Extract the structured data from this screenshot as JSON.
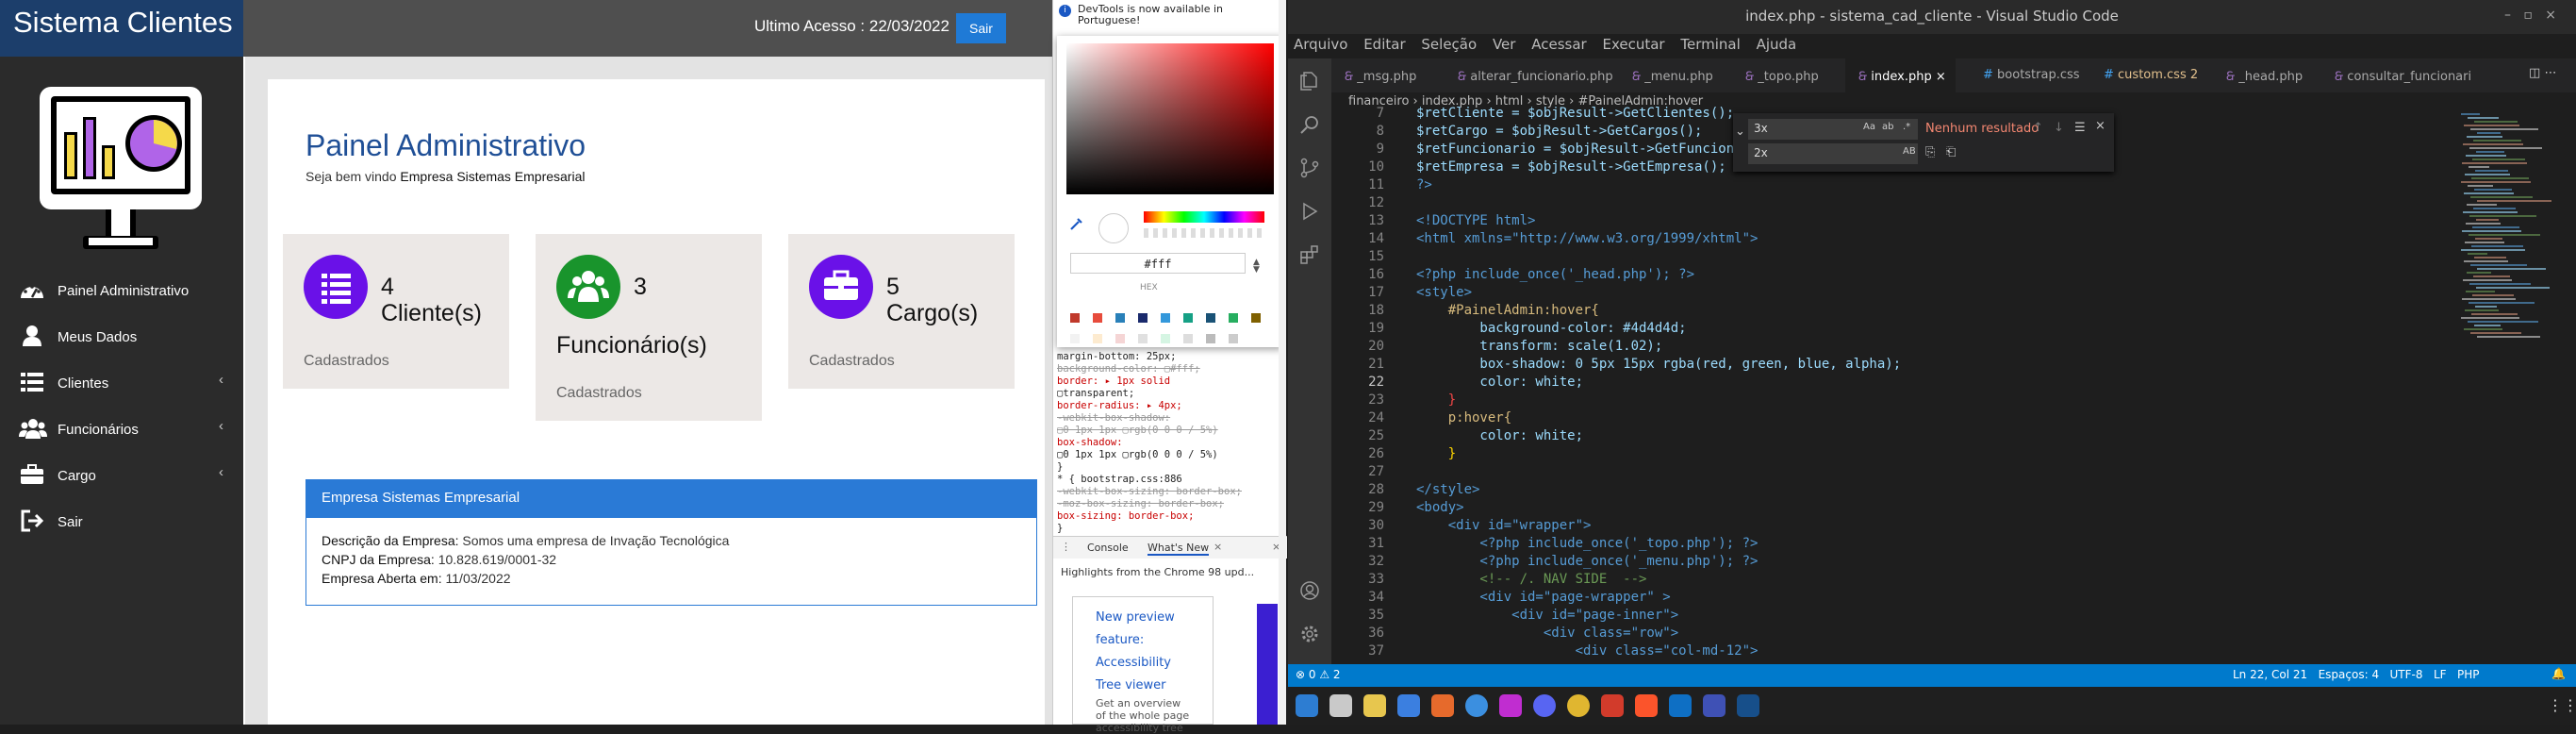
{
  "sistema": {
    "brand": "Sistema Clientes",
    "ultimo_acesso": "Ultimo Acesso : 22/03/2022",
    "sair_button": "Sair",
    "nav": [
      {
        "label": "Painel Administrativo",
        "icon": "dashboard-icon",
        "chevron": ""
      },
      {
        "label": "Meus Dados",
        "icon": "user-icon",
        "chevron": ""
      },
      {
        "label": "Clientes",
        "icon": "list-icon",
        "chevron": "‹"
      },
      {
        "label": "Funcionários",
        "icon": "users-icon",
        "chevron": "‹"
      },
      {
        "label": "Cargo",
        "icon": "briefcase-icon",
        "chevron": "‹"
      },
      {
        "label": "Sair",
        "icon": "sign-out-icon",
        "chevron": ""
      }
    ],
    "title": "Painel Administrativo",
    "welcome_prefix": "Seja bem vindo ",
    "welcome_company": "Empresa Sistemas Empresarial",
    "cards": [
      {
        "count": "4",
        "label": "Cliente(s)",
        "footer": "Cadastrados",
        "color": "#6a11e8",
        "icon": "list-icon"
      },
      {
        "count": "3",
        "label": "Funcionário(s)",
        "footer": "Cadastrados",
        "color": "#19942c",
        "icon": "users-icon"
      },
      {
        "count": "5",
        "label": "Cargo(s)",
        "footer": "Cadastrados",
        "color": "#6a11e8",
        "icon": "briefcase-icon"
      }
    ],
    "empresa": {
      "heading": "Empresa Sistemas Empresarial",
      "desc_label": "Descrição da Empresa:",
      "desc_value": " Somos uma empresa de Invação Tecnológica",
      "cnpj_label": "CNPJ da Empresa:",
      "cnpj_value": " 10.828.619/0001-32",
      "aberta_label": "Empresa Aberta em:",
      "aberta_value": " 11/03/2022"
    }
  },
  "devtools": {
    "notice": "DevTools is now available in Portuguese!",
    "hex_value": "#fff",
    "hex_label": "HEX",
    "css_lines": [
      {
        "text": "margin-bottom: 25px;",
        "cls": ""
      },
      {
        "text": "background-color: ▢#fff;",
        "cls": "s"
      },
      {
        "text": "border: ▸ 1px solid",
        "cls": "p"
      },
      {
        "text": "    ▢transparent;",
        "cls": ""
      },
      {
        "text": "border-radius: ▸ 4px;",
        "cls": "p"
      },
      {
        "text": "-webkit-box-shadow:",
        "cls": "s"
      },
      {
        "text": "    ▢0 1px 1px ▢rgb(0 0 0 / 5%)",
        "cls": "s"
      },
      {
        "text": "box-shadow:",
        "cls": "p"
      },
      {
        "text": "    ▢0 1px 1px ▢rgb(0 0 0 / 5%)",
        "cls": ""
      },
      {
        "text": "}",
        "cls": ""
      },
      {
        "text": "* {            bootstrap.css:886",
        "cls": ""
      },
      {
        "text": "-webkit-box-sizing: border-box;",
        "cls": "s"
      },
      {
        "text": "-moz-box-sizing: border-box;",
        "cls": "s"
      },
      {
        "text": "box-sizing: border-box;",
        "cls": "p"
      },
      {
        "text": "}",
        "cls": ""
      }
    ],
    "tab_console": "Console",
    "tab_whats_new": "What's New",
    "highlights": "Highlights from the Chrome 98 upd...",
    "wn_title": "New preview feature: Accessibility Tree viewer",
    "wn_sub": "Get an overview of the whole page accessibility tree"
  },
  "vscode": {
    "title": "index.php - sistema_cad_cliente - Visual Studio Code",
    "menu": [
      "Arquivo",
      "Editar",
      "Seleção",
      "Ver",
      "Acessar",
      "Executar",
      "Terminal",
      "Ajuda"
    ],
    "tabs": [
      "_msg.php",
      "alterar_funcionario.php",
      "_menu.php",
      "_topo.php",
      "index.php",
      "bootstrap.css",
      "custom.css 2",
      "_head.php",
      "consultar_funcionari"
    ],
    "breadcrumb": "financeiro › index.php › html › style › #PainelAdmin:hover",
    "find_value": "3x",
    "replace_value": "2x",
    "find_result": "Nenhum resultado",
    "lines": [
      {
        "n": "7",
        "t": "$retCliente = $objResult->GetClientes();",
        "c": "#9cdcfe"
      },
      {
        "n": "8",
        "t": "$retCargo = $objResult->GetCargos();",
        "c": "#9cdcfe"
      },
      {
        "n": "9",
        "t": "$retFuncionario = $objResult->GetFuncionario();",
        "c": "#9cdcfe"
      },
      {
        "n": "10",
        "t": "$retEmpresa = $objResult->GetEmpresa();",
        "c": "#9cdcfe"
      },
      {
        "n": "11",
        "t": "?>",
        "c": "#569cd6"
      },
      {
        "n": "12",
        "t": "",
        "c": "#d4d4d4"
      },
      {
        "n": "13",
        "t": "<!DOCTYPE html>",
        "c": "#569cd6"
      },
      {
        "n": "14",
        "t": "<html xmlns=\"http://www.w3.org/1999/xhtml\">",
        "c": "#569cd6"
      },
      {
        "n": "15",
        "t": "",
        "c": "#d4d4d4"
      },
      {
        "n": "16",
        "t": "<?php include_once('_head.php'); ?>",
        "c": "#569cd6"
      },
      {
        "n": "17",
        "t": "<style>",
        "c": "#569cd6"
      },
      {
        "n": "18",
        "t": "    #PainelAdmin:hover{",
        "c": "#d7ba7d"
      },
      {
        "n": "19",
        "t": "        background-color: #4d4d4d;",
        "c": "#9cdcfe"
      },
      {
        "n": "20",
        "t": "        transform: scale(1.02);",
        "c": "#9cdcfe"
      },
      {
        "n": "21",
        "t": "        box-shadow: 0 5px 15px rgba(red, green, blue, alpha);",
        "c": "#9cdcfe"
      },
      {
        "n": "22",
        "t": "        color: white;",
        "c": "#9cdcfe"
      },
      {
        "n": "23",
        "t": "    }",
        "c": "#f44747"
      },
      {
        "n": "24",
        "t": "    p:hover{",
        "c": "#d7ba7d"
      },
      {
        "n": "25",
        "t": "        color: white;",
        "c": "#9cdcfe"
      },
      {
        "n": "26",
        "t": "    }",
        "c": "#ffd700"
      },
      {
        "n": "27",
        "t": "",
        "c": "#d4d4d4"
      },
      {
        "n": "28",
        "t": "</style>",
        "c": "#569cd6"
      },
      {
        "n": "29",
        "t": "<body>",
        "c": "#569cd6"
      },
      {
        "n": "30",
        "t": "    <div id=\"wrapper\">",
        "c": "#569cd6"
      },
      {
        "n": "31",
        "t": "        <?php include_once('_topo.php'); ?>",
        "c": "#569cd6"
      },
      {
        "n": "32",
        "t": "        <?php include_once('_menu.php'); ?>",
        "c": "#569cd6"
      },
      {
        "n": "33",
        "t": "        <!-- /. NAV SIDE  -->",
        "c": "#6a9955"
      },
      {
        "n": "34",
        "t": "        <div id=\"page-wrapper\" >",
        "c": "#569cd6"
      },
      {
        "n": "35",
        "t": "            <div id=\"page-inner\">",
        "c": "#569cd6"
      },
      {
        "n": "36",
        "t": "                <div class=\"row\">",
        "c": "#569cd6"
      },
      {
        "n": "37",
        "t": "                    <div class=\"col-md-12\">",
        "c": "#569cd6"
      }
    ],
    "status_left": "⊗ 0 ⚠ 2",
    "status_right": "Ln 22, Col 21   Espaços: 4   UTF-8   LF   PHP"
  }
}
